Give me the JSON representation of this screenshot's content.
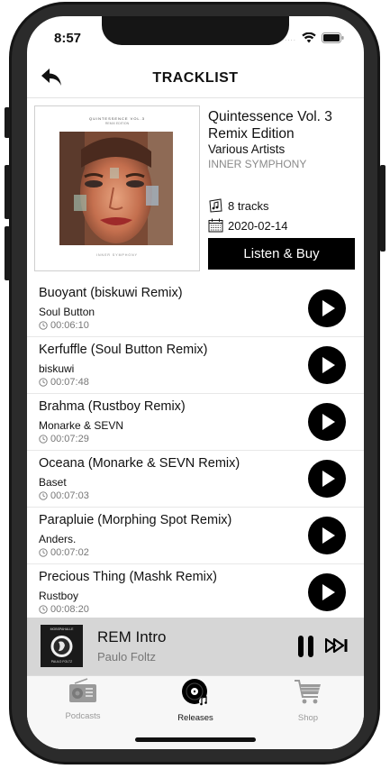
{
  "status": {
    "time": "8:57",
    "signal_dots": "....."
  },
  "nav": {
    "title": "TRACKLIST"
  },
  "release": {
    "cover_title": "QUINTESSENCE VOL.3",
    "cover_subtitle": "REMIX EDITION",
    "cover_label": "INNER SYMPHONY",
    "title": "Quintessence Vol. 3 Remix Edition",
    "artist": "Various Artists",
    "label": "INNER SYMPHONY",
    "track_count": "8 tracks",
    "date": "2020-02-14",
    "buy_label": "Listen & Buy"
  },
  "tracks": [
    {
      "title": "Buoyant (biskuwi Remix)",
      "artist": "Soul Button",
      "duration": "00:06:10"
    },
    {
      "title": "Kerfuffle (Soul Button Remix)",
      "artist": "biskuwi",
      "duration": "00:07:48"
    },
    {
      "title": "Brahma (Rustboy Remix)",
      "artist": "Monarke & SEVN",
      "duration": "00:07:29"
    },
    {
      "title": "Oceana (Monarke & SEVN Remix)",
      "artist": "Baset",
      "duration": "00:07:03"
    },
    {
      "title": "Parapluie (Morphing Spot Remix)",
      "artist": "Anders.",
      "duration": "00:07:02"
    },
    {
      "title": "Precious Thing (Mashk Remix)",
      "artist": "Rustboy",
      "duration": "00:08:20"
    }
  ],
  "now_playing": {
    "art_text_top": "MOBSPAHALLE",
    "art_text_bottom": "PAULO FOLTZ",
    "title": "REM Intro",
    "artist": "Paulo Foltz"
  },
  "tabs": [
    {
      "label": "Podcasts",
      "icon": "radio-icon",
      "active": false
    },
    {
      "label": "Releases",
      "icon": "vinyl-icon",
      "active": true
    },
    {
      "label": "Shop",
      "icon": "cart-icon",
      "active": false
    }
  ],
  "colors": {
    "accent": "#000000",
    "inactive_tab": "#9a9a9a",
    "now_playing_bg": "#d6d6d6"
  }
}
